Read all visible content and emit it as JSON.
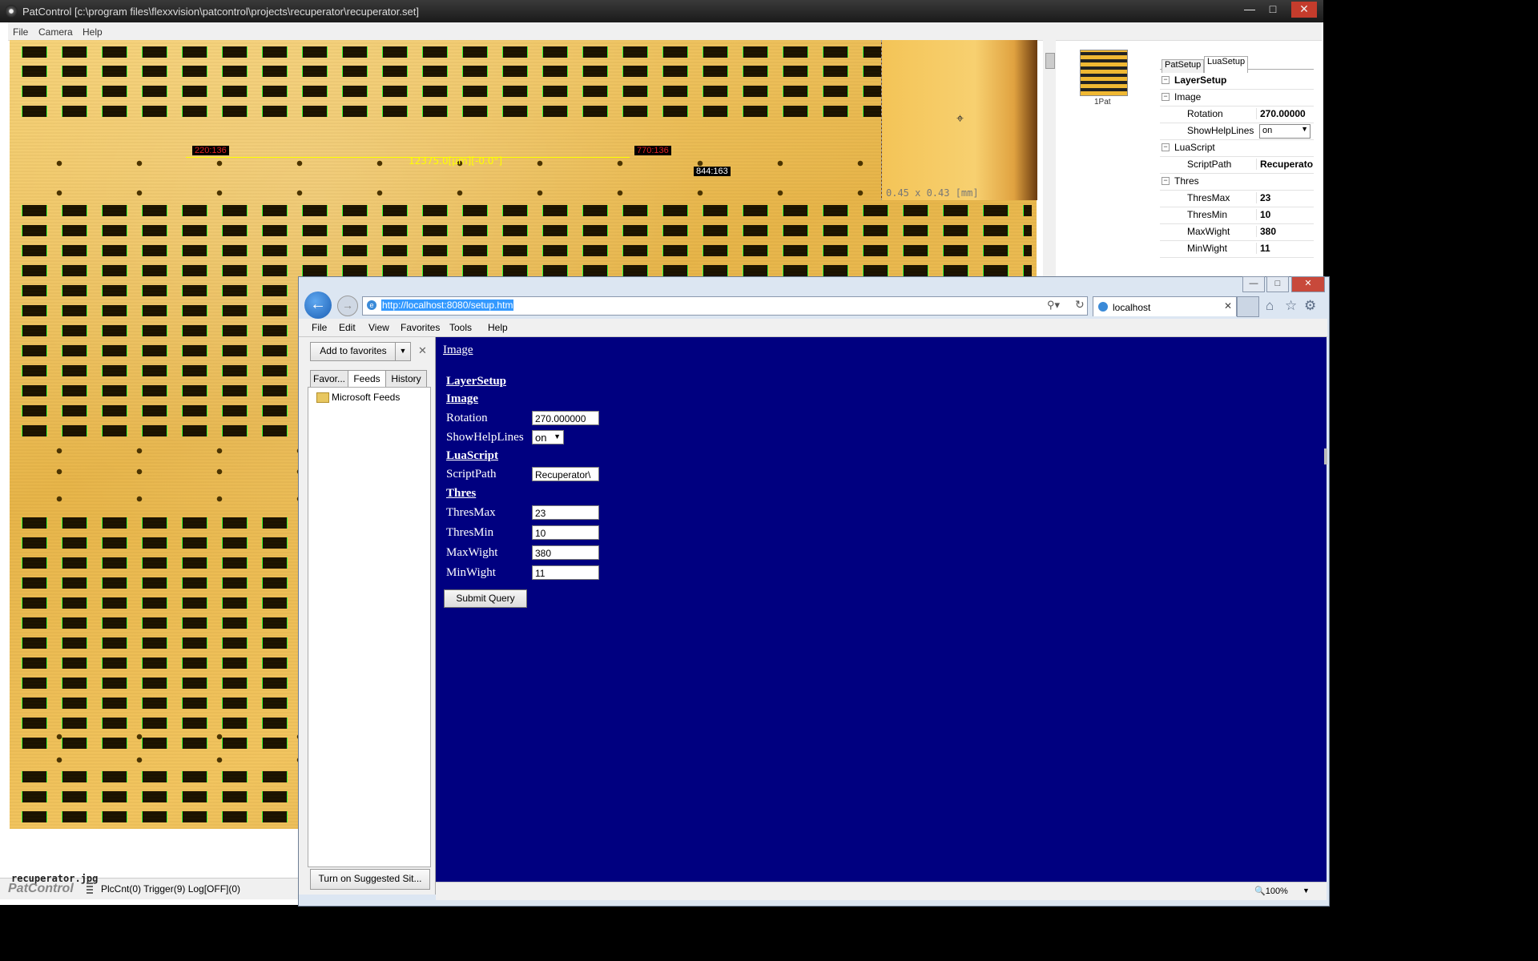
{
  "patcontrol": {
    "title": "PatControl [c:\\program files\\flexxvision\\patcontrol\\projects\\recuperator\\recuperator.set]",
    "menu": [
      "File",
      "Camera",
      "Help"
    ],
    "overlays": {
      "left_coord": "220:136",
      "right_coord": "770:136",
      "measure": "12375.0[µm][-0.0°]",
      "cursor_coord": "844:163",
      "zoom_dim": "0.45 x 0.43 [mm]"
    },
    "thumbnail_label": "1Pat",
    "tabs": [
      "PatSetup",
      "LuaSetup"
    ],
    "property_grid": {
      "layer_setup": "LayerSetup",
      "image": "Image",
      "rotation_label": "Rotation",
      "rotation_value": "270.00000",
      "showhelplines_label": "ShowHelpLines",
      "showhelplines_value": "on",
      "luascript": "LuaScript",
      "scriptpath_label": "ScriptPath",
      "scriptpath_value": "Recuperato",
      "thres": "Thres",
      "thresmax_label": "ThresMax",
      "thresmax_value": "23",
      "thresmin_label": "ThresMin",
      "thresmin_value": "10",
      "maxwight_label": "MaxWight",
      "maxwight_value": "380",
      "minwight_label": "MinWight",
      "minwight_value": "11"
    },
    "filename": "recuperator.jpg",
    "logo": "PatControl",
    "status": "PlcCnt(0) Trigger(9) Log[OFF](0)"
  },
  "ie": {
    "url": "http://localhost:8080/setup.htm",
    "tab_label": "localhost",
    "menu": [
      "File",
      "Edit",
      "View",
      "Favorites",
      "Tools",
      "Help"
    ],
    "favorites": {
      "add_button": "Add to favorites",
      "tabs": [
        "Favor...",
        "Feeds",
        "History"
      ],
      "folder": "Microsoft Feeds",
      "suggest_button": "Turn on Suggested Sit..."
    },
    "page": {
      "top_link": "Image",
      "layer_setup": "LayerSetup",
      "image": "Image",
      "rotation_label": "Rotation",
      "rotation_value": "270.000000",
      "showhelplines_label": "ShowHelpLines",
      "showhelplines_value": "on",
      "luascript": "LuaScript",
      "scriptpath_label": "ScriptPath",
      "scriptpath_value": "Recuperator\\",
      "thres": "Thres",
      "thresmax_label": "ThresMax",
      "thresmax_value": "23",
      "thresmin_label": "ThresMin",
      "thresmin_value": "10",
      "maxwight_label": "MaxWight",
      "maxwight_value": "380",
      "minwight_label": "MinWight",
      "minwight_value": "11",
      "submit": "Submit Query"
    },
    "zoom": "100%"
  },
  "colors": {
    "page_background": "#000080",
    "detection_outline": "#32ff32",
    "close_button": "#c43c2c"
  }
}
